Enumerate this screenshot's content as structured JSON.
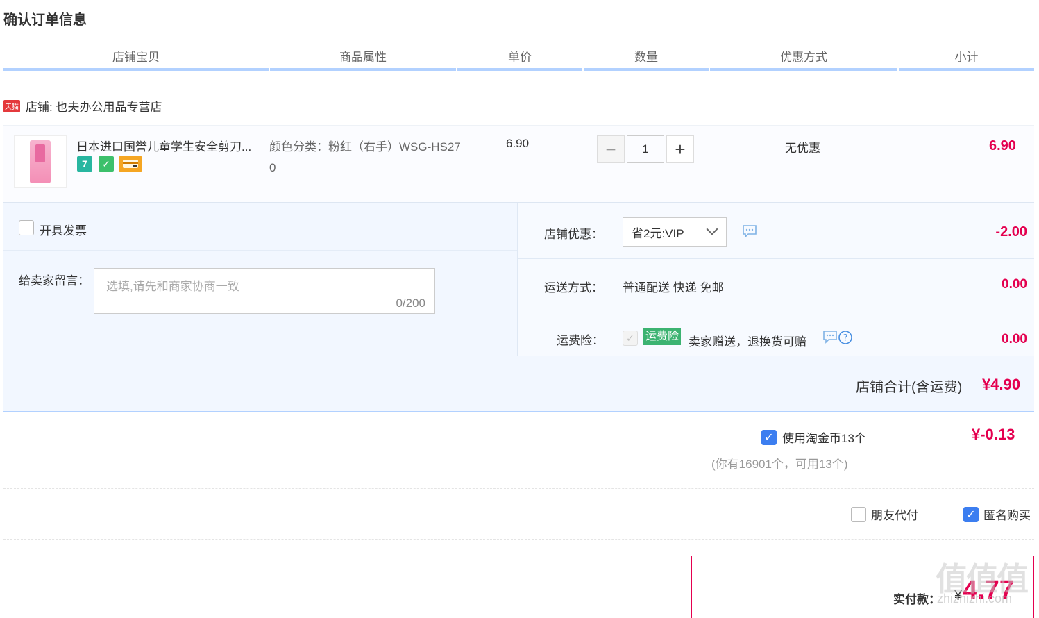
{
  "page_title": "确认订单信息",
  "columns": [
    "店铺宝贝",
    "商品属性",
    "单价",
    "数量",
    "优惠方式",
    "小计"
  ],
  "store": {
    "logo_text": "天猫",
    "label": "店铺: 也夫办公用品专营店"
  },
  "item": {
    "title": "日本进口国誉儿童学生安全剪刀...",
    "badges": [
      "7",
      "✓"
    ],
    "attr": "颜色分类：粉红（右手）WSG-HS270",
    "price": "6.90",
    "qty_minus": "−",
    "qty": "1",
    "qty_plus": "+",
    "discount": "无优惠",
    "subtotal": "6.90"
  },
  "invoice": {
    "label": "开具发票"
  },
  "message": {
    "label": "给卖家留言：",
    "placeholder": "选填,请先和商家协商一致",
    "counter": "0/200"
  },
  "store_discount": {
    "label": "店铺优惠：",
    "selected": "省2元:VIP",
    "amount": "-2.00"
  },
  "shipping": {
    "label": "运送方式：",
    "value": "普通配送 快递 免邮",
    "amount": "0.00"
  },
  "insurance": {
    "label": "运费险：",
    "tag": "运费险",
    "desc": "卖家赠送，退换货可赔",
    "amount": "0.00"
  },
  "store_total": {
    "label": "店铺合计(含运费)",
    "amount": "¥4.90"
  },
  "coins": {
    "label": "使用淘金币13个",
    "note": "(你有16901个，可用13个)",
    "amount": "¥-0.13"
  },
  "options": {
    "friend_pay": "朋友代付",
    "anonymous": "匿名购买"
  },
  "payment": {
    "label": "实付款：",
    "currency": "¥",
    "amount": "4.77"
  },
  "watermark": {
    "main": "值值值",
    "sub": "zhizhizhi.com"
  },
  "colors": {
    "accent": "#e4004f",
    "header_border": "#b2d1ff",
    "panel_bg": "#f2f7ff",
    "checkbox": "#3c7ef0",
    "insurance_tag": "#3cb371"
  }
}
